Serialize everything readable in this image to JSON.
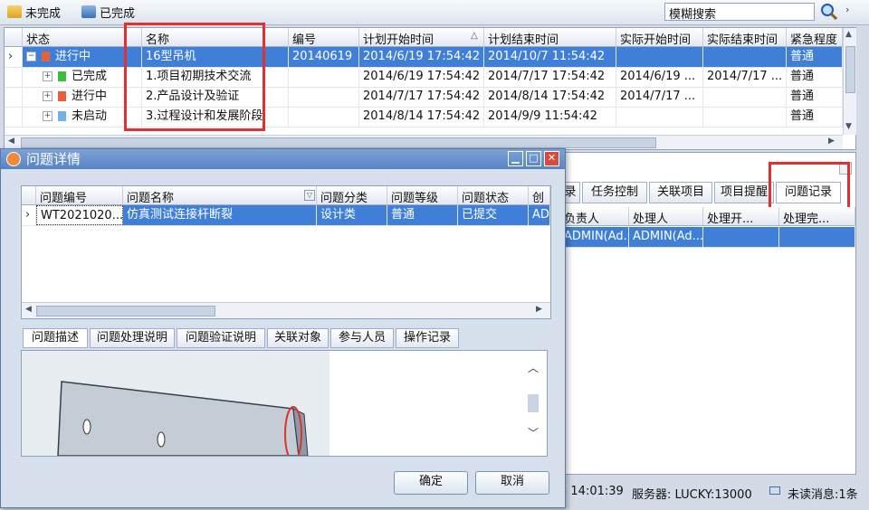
{
  "toolbar": {
    "incomplete_label": "未完成",
    "complete_label": "已完成",
    "search_value": "模糊搜索"
  },
  "grid": {
    "headers": [
      "状态",
      "名称",
      "编号",
      "计划开始时间",
      "计划结束时间",
      "实际开始时间",
      "实际结束时间",
      "紧急程度"
    ],
    "rows": [
      {
        "status": "进行中",
        "name": "16型吊机",
        "code": "20140619",
        "plan_start": "2014/6/19 17:54:42",
        "plan_end": "2014/10/7 11:54:42",
        "act_start": "",
        "act_end": "",
        "urgency": "普通"
      },
      {
        "status": "已完成",
        "name": "1.项目初期技术交流",
        "code": "",
        "plan_start": "2014/6/19 17:54:42",
        "plan_end": "2014/7/17 17:54:42",
        "act_start": "2014/6/19 ...",
        "act_end": "2014/7/17 ...",
        "urgency": "普通"
      },
      {
        "status": "进行中",
        "name": "2.产品设计及验证",
        "code": "",
        "plan_start": "2014/7/17 17:54:42",
        "plan_end": "2014/8/14 17:54:42",
        "act_start": "2014/7/17 ...",
        "act_end": "",
        "urgency": "普通"
      },
      {
        "status": "未启动",
        "name": "3.过程设计和发展阶段",
        "code": "",
        "plan_start": "2014/8/14 17:54:42",
        "plan_end": "2014/9/9 11:54:42",
        "act_start": "",
        "act_end": "",
        "urgency": "普通"
      }
    ]
  },
  "right_panel": {
    "tabs": [
      "录",
      "任务控制",
      "关联项目",
      "项目提醒",
      "问题记录"
    ],
    "headers": [
      "负责人",
      "处理人",
      "处理开...",
      "处理完..."
    ],
    "row": [
      "ADMIN(Ad...",
      "ADMIN(Ad...",
      "",
      ""
    ]
  },
  "status_bar": {
    "time": "5 14:01:39",
    "server": "服务器: LUCKY:13000",
    "unread": "未读消息:1条"
  },
  "dialog": {
    "title": "问题详情",
    "headers": [
      "问题编号",
      "问题名称",
      "问题分类",
      "问题等级",
      "问题状态",
      "创"
    ],
    "row": [
      "WT2021020...",
      "仿真测试连接杆断裂",
      "设计类",
      "普通",
      "已提交",
      "AD"
    ],
    "tabs": [
      "问题描述",
      "问题处理说明",
      "问题验证说明",
      "关联对象",
      "参与人员",
      "操作记录"
    ],
    "ok_label": "确定",
    "cancel_label": "取消"
  },
  "colors": {
    "selection": "#3f7fd8",
    "highlight_box": "#e03030",
    "title_bar": "#5883c4"
  }
}
